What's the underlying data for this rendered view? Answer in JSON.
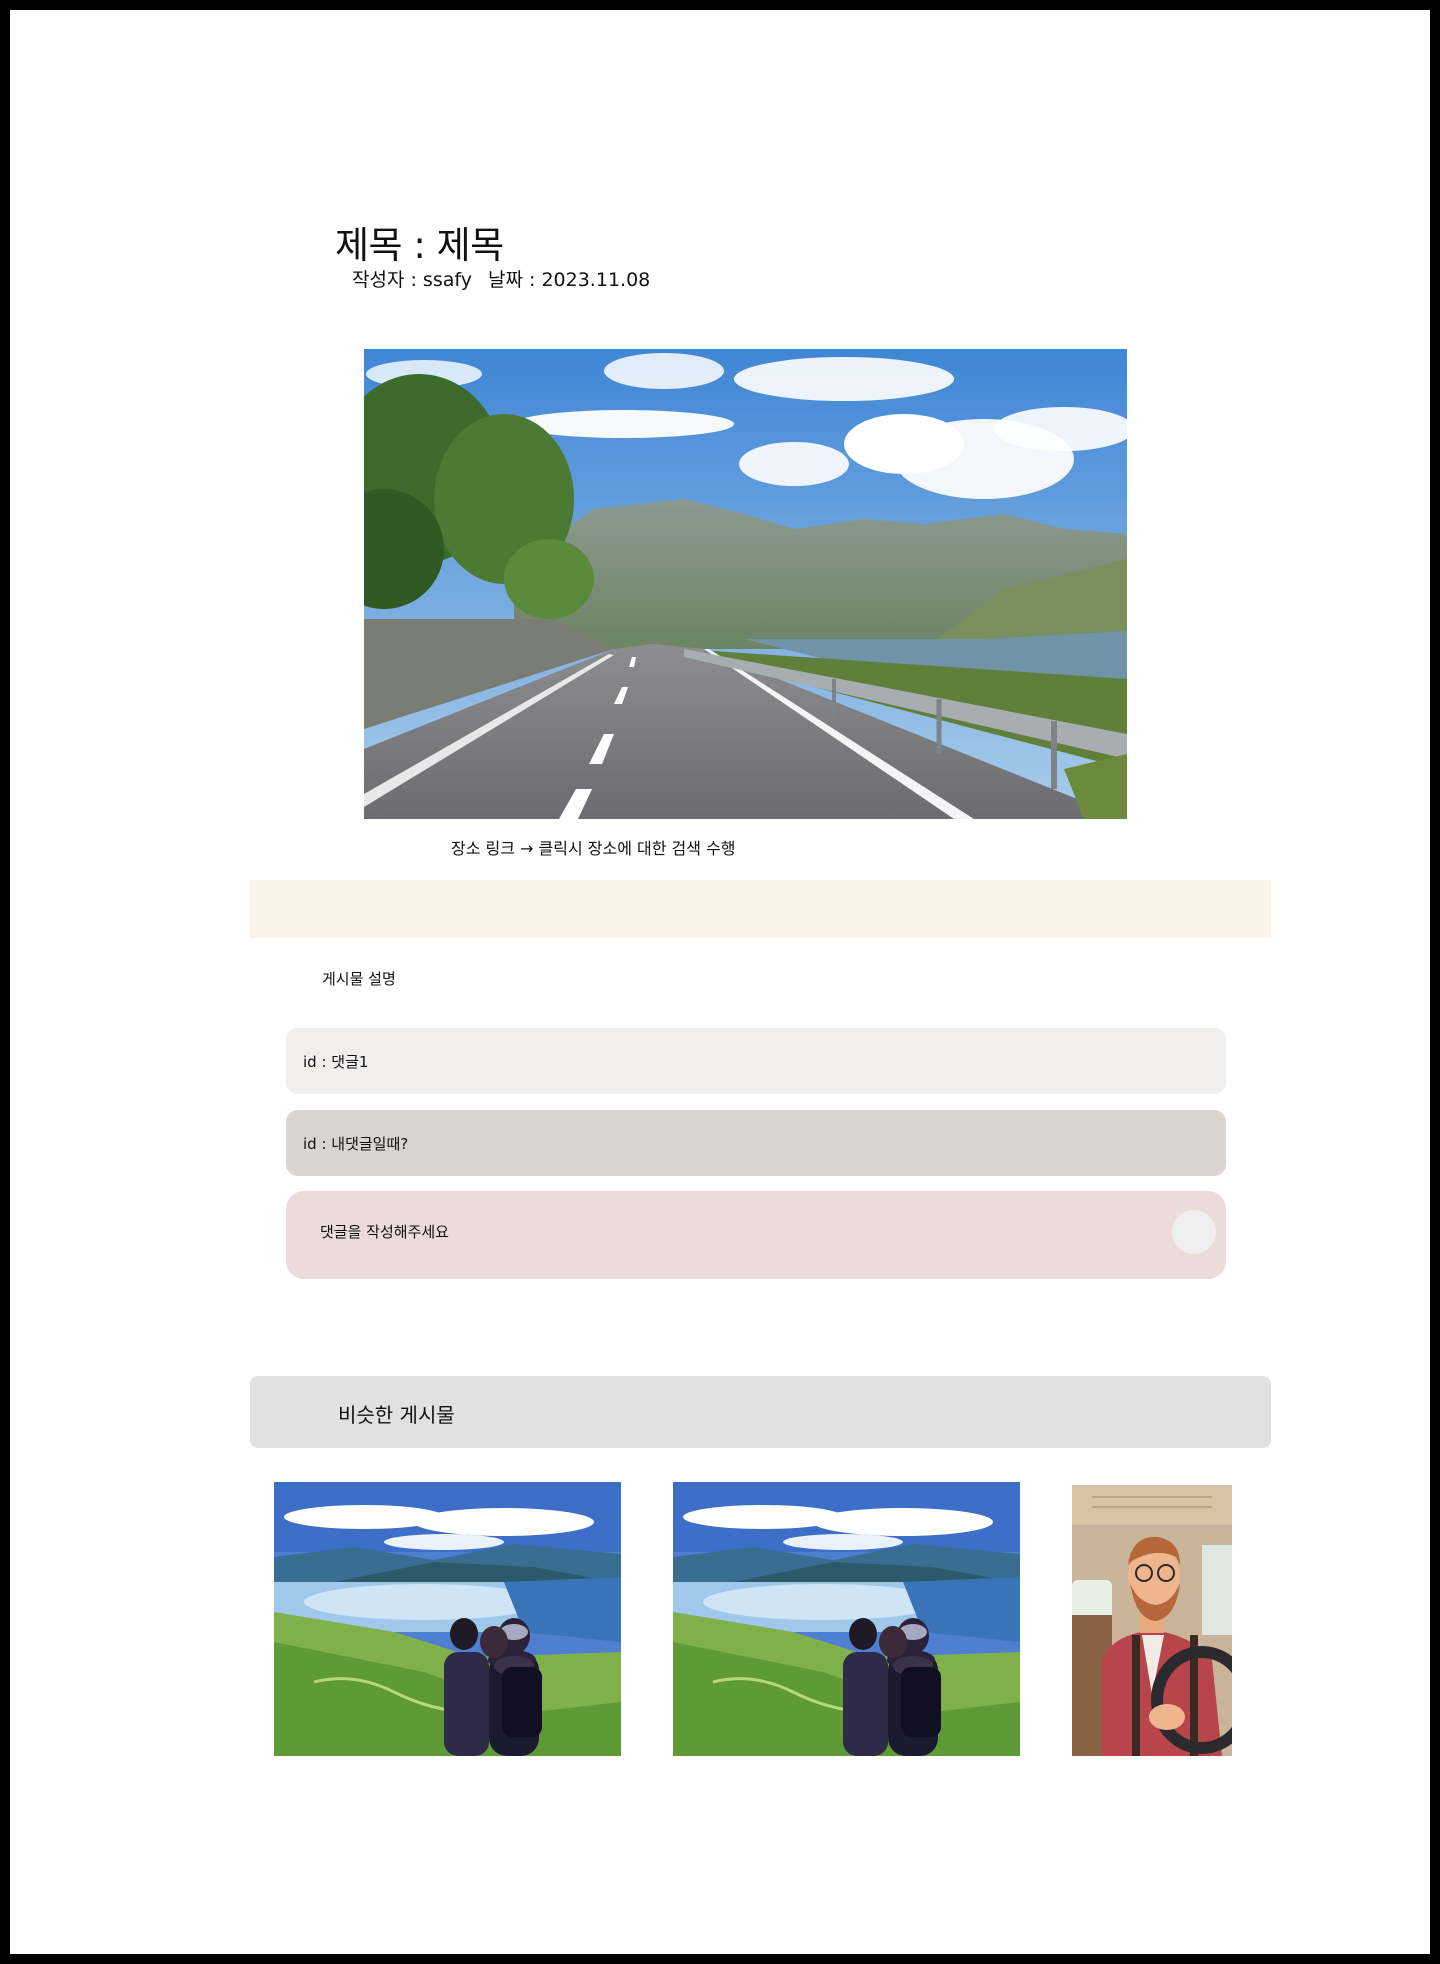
{
  "post": {
    "title": "제목 : 제목",
    "author_label": "작성자 : ssafy",
    "date_label": "날짜 : 2023.11.08"
  },
  "place_link": "장소 링크 → 클릭시 장소에 대한 검색 수행",
  "description": "게시물 설명",
  "comments": [
    {
      "text": "id : 댓글1"
    },
    {
      "text": "id : 내댓글일때?"
    }
  ],
  "comment_input": {
    "placeholder": "댓글을 작성해주세요"
  },
  "similar": {
    "label": "비슷한 게시물"
  },
  "colors": {
    "beige_band": "#fbf3e9",
    "comment_1": "#f1efee",
    "comment_2": "#dbd2d2",
    "comment_input": "#ebdcdb",
    "similar_header": "#e1e1e1"
  }
}
